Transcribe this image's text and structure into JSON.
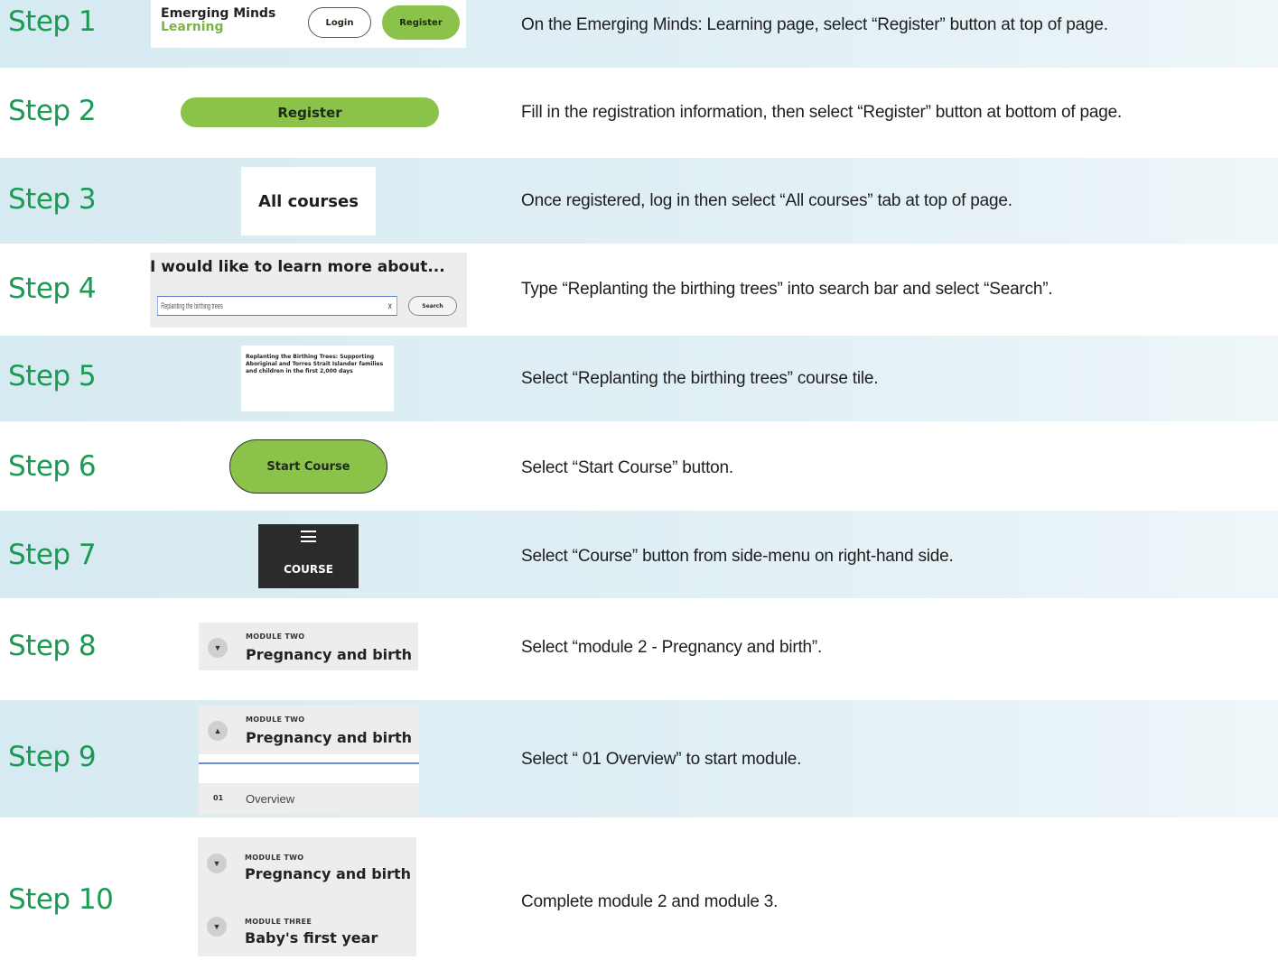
{
  "steps": [
    {
      "label": "Step 1",
      "text": "On the Emerging Minds: Learning page, select “Register” button at top of page."
    },
    {
      "label": "Step 2",
      "text": "Fill in the registration information, then select “Register” button at bottom of page."
    },
    {
      "label": "Step 3",
      "text": "Once registered, log in then select “All courses” tab at top of page."
    },
    {
      "label": "Step 4",
      "text": "Type “Replanting the birthing trees” into search bar and select “Search”."
    },
    {
      "label": "Step 5",
      "text": "Select “Replanting the birthing trees” course tile."
    },
    {
      "label": "Step 6",
      "text": "Select “Start Course” button."
    },
    {
      "label": "Step 7",
      "text": "Select “Course” button from side-menu on right-hand side."
    },
    {
      "label": "Step 8",
      "text": "Select “module 2 - Pregnancy and birth”."
    },
    {
      "label": "Step 9",
      "text": "Select “ 01 Overview” to start module."
    },
    {
      "label": "Step 10",
      "text": "Complete module 2 and module 3."
    }
  ],
  "shot1": {
    "brand_line1": "Emerging Minds",
    "brand_line2": "Learning",
    "login": "Login",
    "register": "Register"
  },
  "shot2": {
    "register": "Register"
  },
  "shot3": {
    "tab": "All courses"
  },
  "shot4": {
    "heading": "I would like to learn more about...",
    "query": "Replanting the birthing trees",
    "clear": "×",
    "search": "Search"
  },
  "shot5": {
    "tile_text": "Replanting the Birthing Trees: Supporting Aboriginal and Torres Strait Islander families and children in the first 2,000 days"
  },
  "shot6": {
    "button": "Start Course"
  },
  "shot7": {
    "label": "COURSE"
  },
  "shot8": {
    "module_small": "MODULE TWO",
    "module_title": "Pregnancy and birth"
  },
  "shot9": {
    "module_small": "MODULE TWO",
    "module_title": "Pregnancy and birth",
    "item_num": "01",
    "item_label": "Overview"
  },
  "shot10": {
    "m2_small": "MODULE TWO",
    "m2_title": "Pregnancy and birth",
    "m3_small": "MODULE THREE",
    "m3_title": "Baby's first year"
  },
  "colors": {
    "green_text": "#1a9a52",
    "band": "#d6eaf1",
    "button_green": "#8bc34a",
    "brand_green": "#7cb342"
  }
}
